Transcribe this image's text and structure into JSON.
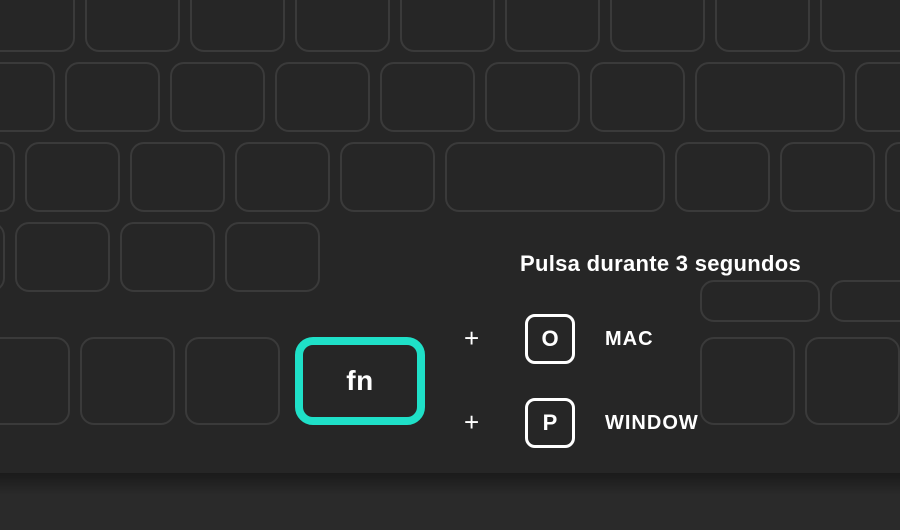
{
  "instruction": "Pulsa durante 3 segundos",
  "fn_key": {
    "label": "fn"
  },
  "combos": [
    {
      "plus": "+",
      "key": "O",
      "os": "MAC"
    },
    {
      "plus": "+",
      "key": "P",
      "os": "WINDOW"
    }
  ],
  "colors": {
    "accent": "#1fe0c8",
    "text": "#ffffff",
    "bg_keyboard": "#262626",
    "bg_floor": "#2a2a2a",
    "ghost_key_border": "#3a3a3a"
  }
}
